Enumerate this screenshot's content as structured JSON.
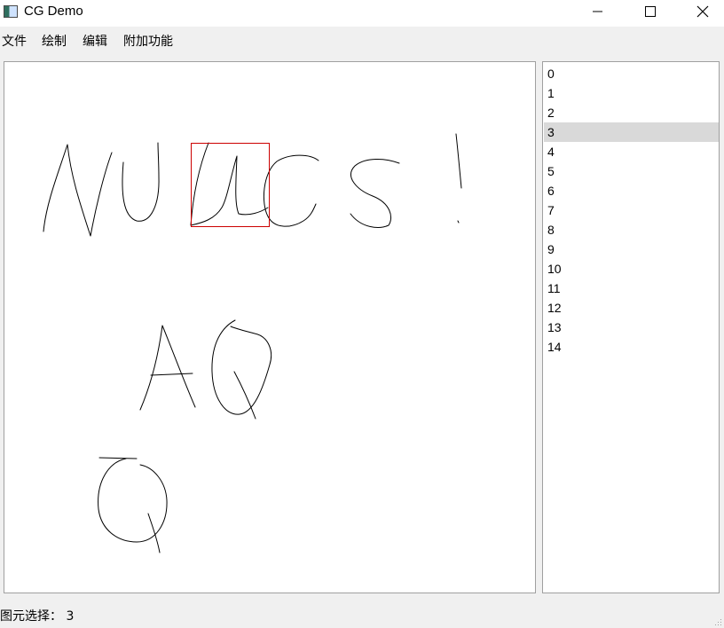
{
  "window": {
    "title": "CG Demo",
    "icon": "app-icon",
    "controls": [
      "minimize-icon",
      "maximize-icon",
      "close-icon"
    ]
  },
  "menu": {
    "items": [
      "文件",
      "绘制",
      "编辑",
      "附加功能"
    ]
  },
  "canvas": {
    "selection_color": "#cc0000",
    "stroke_color": "#000000"
  },
  "primitive_list": {
    "items": [
      "0",
      "1",
      "2",
      "3",
      "4",
      "5",
      "6",
      "7",
      "8",
      "9",
      "10",
      "11",
      "12",
      "13",
      "14"
    ],
    "selected_index": 3,
    "selected_background": "#d9d9d9"
  },
  "status": {
    "label": "图元选择：",
    "value": "3"
  }
}
